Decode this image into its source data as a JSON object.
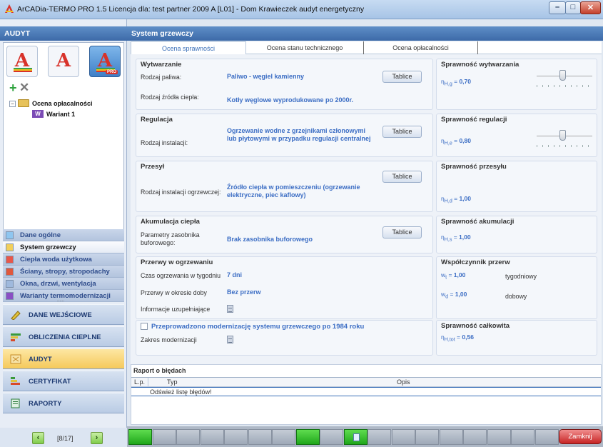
{
  "window": {
    "title": "ArCADia-TERMO PRO 1.5 Licencja dla: test partner 2009 A [L01] - Dom Krawieczek audyt energetyczny",
    "minimize_glyph": "–",
    "maximize_glyph": "□",
    "close_glyph": "✕"
  },
  "left": {
    "header": "AUDYT",
    "tools": [
      {
        "icon": "at-icon",
        "letter": "A"
      },
      {
        "icon": "at-icon",
        "letter": "A"
      },
      {
        "icon": "at-pro-icon",
        "letter": "A",
        "badge": "PRO"
      }
    ],
    "tree": {
      "minus": "−",
      "root": "Ocena opłacalności",
      "child_badge": "W",
      "child": "Wariant 1"
    },
    "nav_items": [
      {
        "label": "Dane ogólne",
        "color": "#8fc6f0"
      },
      {
        "label": "System grzewczy",
        "color": "#f2cf5b"
      },
      {
        "label": "Ciepła woda użytkowa",
        "color": "#e8574a"
      },
      {
        "label": "Ściany, stropy, stropodachy",
        "color": "#e0583c"
      },
      {
        "label": "Okna, drzwi, wentylacja",
        "color": "#9fb9dd"
      },
      {
        "label": "Warianty termomodernizacji",
        "color": "#8a4fc4"
      }
    ],
    "dots": "......",
    "sections": [
      {
        "label": "DANE WEJŚCIOWE",
        "icon": "pencil-icon",
        "color": "#e0c23b"
      },
      {
        "label": "OBLICZENIA CIEPLNE",
        "icon": "bars-icon",
        "color": "#3a9a3a"
      },
      {
        "label": "AUDYT",
        "icon": "audit-icon",
        "color": "#c58b2a"
      },
      {
        "label": "CERTYFIKAT",
        "icon": "certificate-icon",
        "color": "#d84a2a"
      },
      {
        "label": "RAPORTY",
        "icon": "report-icon",
        "color": "#2a7a3a"
      }
    ],
    "pager": {
      "prev": "‹",
      "next": "›",
      "count": "[8/17]"
    }
  },
  "main": {
    "header": "System grzewczy",
    "tabs": [
      "Ocena sprawności",
      "Ocena stanu technicznego",
      "Ocena opłacalności"
    ],
    "wytwarzanie": {
      "title": "Wytwarzanie",
      "fuel_label": "Rodzaj paliwa:",
      "fuel_value": "Paliwo - węgiel kamienny",
      "source_label": "Rodzaj źródła ciepła:",
      "source_value": "Kotły węglowe wyprodukowane po 2000r.",
      "button": "Tablice"
    },
    "sprawnosc_wytwarzania": {
      "title": "Sprawność wytwarzania",
      "eta_symbol": "η",
      "eta_sub": "H,g",
      "value": "0,70"
    },
    "regulacja": {
      "title": "Regulacja",
      "label": "Rodzaj instalacji:",
      "value": "Ogrzewanie wodne z grzejnikami członowymi lub płytowymi w przypadku regulacji centralnej",
      "button": "Tablice"
    },
    "sprawnosc_regulacji": {
      "title": "Sprawność regulacji",
      "eta_symbol": "η",
      "eta_sub": "H,e",
      "value": "0,80"
    },
    "przesyl": {
      "title": "Przesył",
      "label": "Rodzaj instalacji ogrzewczej:",
      "value": "Źródło ciepła w pomieszczeniu (ogrzewanie elektryczne, piec kaflowy)",
      "button": "Tablice"
    },
    "sprawnosc_przesylu": {
      "title": "Sprawność przesyłu",
      "eta_symbol": "η",
      "eta_sub": "H,d",
      "value": "1,00"
    },
    "akumulacja": {
      "title": "Akumulacja ciepła",
      "label": "Parametry zasobnika buforowego:",
      "value": "Brak zasobnika buforowego",
      "button": "Tablice"
    },
    "sprawnosc_akumulacji": {
      "title": "Sprawność akumulacji",
      "eta_symbol": "η",
      "eta_sub": "H,s",
      "value": "1,00"
    },
    "przerwy": {
      "title": "Przerwy w ogrzewaniu",
      "week_label": "Czas ogrzewania w tygodniu",
      "week_value": "7 dni",
      "day_label": "Przerwy w okresie doby",
      "day_value": "Bez przerw",
      "info_label": "Informacje uzupełniające"
    },
    "wspolczynnik": {
      "title": "Współczynnik przerw",
      "wt_symbol": "w",
      "wt_sub": "t",
      "wt_value": "1,00",
      "wt_desc": "tygodniowy",
      "wd_symbol": "w",
      "wd_sub": "d",
      "wd_value": "1,00",
      "wd_desc": "dobowy"
    },
    "modernizacja": {
      "checkbox_label": "Przeprowadzono modernizację systemu grzewczego po 1984 roku",
      "range_label": "Zakres modernizacji"
    },
    "sprawnosc_calkowita": {
      "title": "Sprawność całkowita",
      "eta_symbol": "η",
      "eta_sub": "H,tot",
      "value": "0,56"
    }
  },
  "report": {
    "title": "Raport o błędach",
    "columns": [
      "L.p.",
      "Typ",
      "Opis"
    ],
    "row": "Odśwież listę błędów!"
  },
  "statusbar": {
    "segments": [
      "green",
      "grey",
      "grey",
      "grey",
      "grey",
      "grey",
      "grey",
      "green",
      "grey",
      "doc",
      "grey",
      "grey",
      "grey",
      "grey",
      "grey",
      "grey",
      "grey",
      "grey"
    ],
    "close_button": "Zamknij"
  },
  "colors": {
    "accent_blue": "#3b6dc4",
    "header_blue": "#3d6aa8",
    "green": "#1fa71b",
    "close_red": "#c72424"
  }
}
